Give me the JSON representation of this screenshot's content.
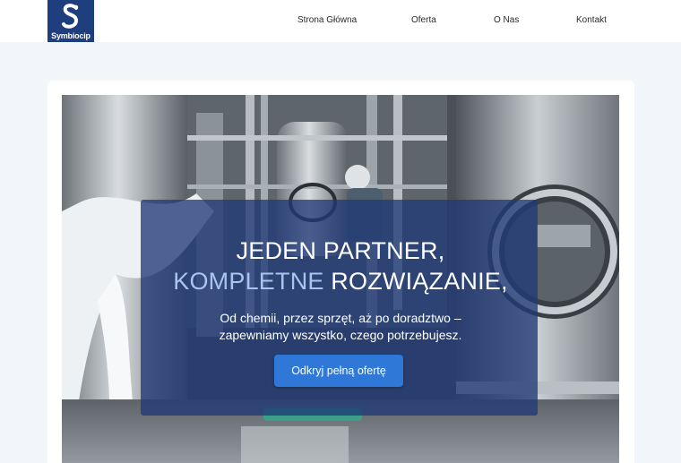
{
  "brand": {
    "name": "Symbiocip",
    "color": "#1f3e7e"
  },
  "nav": {
    "items": [
      {
        "label": "Strona Główna"
      },
      {
        "label": "Oferta"
      },
      {
        "label": "O Nas"
      },
      {
        "label": "Kontakt"
      }
    ]
  },
  "hero": {
    "headline_line1": "JEDEN PARTNER,",
    "headline_line2_accent": "KOMPLETNE",
    "headline_line2_rest": " ROZWIĄZANIE,",
    "subtitle_line1": "Od chemii, przez sprzęt, aż po doradztwo –",
    "subtitle_line2": "zapewniamy wszystko, czego potrzebujesz.",
    "cta_label": "Odkryj pełną ofertę",
    "accent_color": "#a8c4ef",
    "cta_color": "#2f78d8"
  }
}
